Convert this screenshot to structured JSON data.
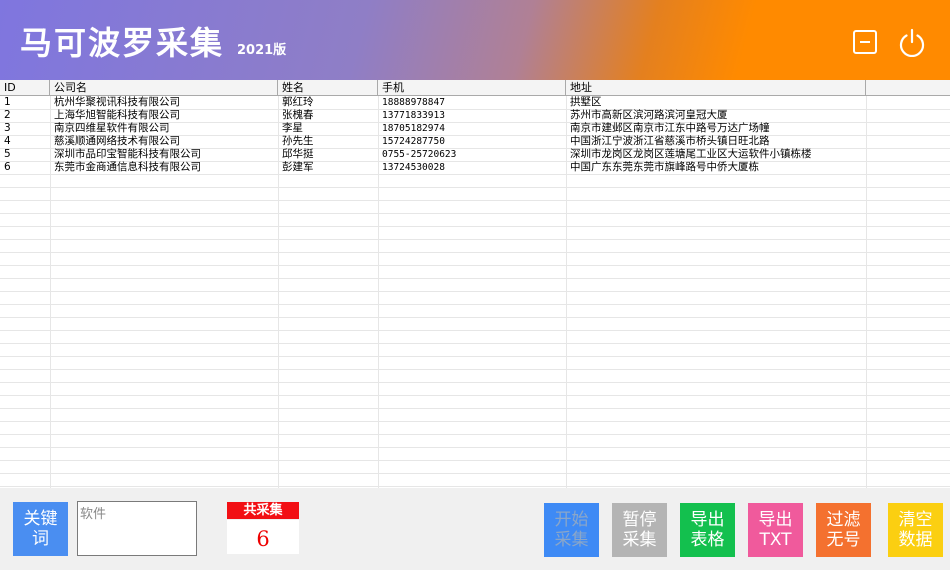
{
  "header": {
    "title": "马可波罗采集",
    "version": "2021版",
    "colors": {
      "gradient_start": "#7f76df",
      "gradient_end": "#ff8a00"
    }
  },
  "table": {
    "columns": [
      "ID",
      "公司名",
      "姓名",
      "手机",
      "地址"
    ],
    "rows": [
      [
        "1",
        "杭州华聚视讯科技有限公司",
        "郭红玲",
        "18888978847",
        "拱墅区"
      ],
      [
        "2",
        "上海华旭智能科技有限公司",
        "张槐春",
        "13771833913",
        "苏州市高新区滨河路滨河皇冠大厦"
      ],
      [
        "3",
        "南京四维星软件有限公司",
        "李星",
        "18705182974",
        "南京市建邺区南京市江东中路号万达广场幢"
      ],
      [
        "4",
        "慈溪顺通网络技术有限公司",
        "孙先生",
        "15724287750",
        "中国浙江宁波浙江省慈溪市桥头镇日旺北路"
      ],
      [
        "5",
        "深圳市品印宝智能科技有限公司",
        "邱华挺",
        "0755-25720623",
        "深圳市龙岗区龙岗区莲塘尾工业区大运软件小镇栋楼"
      ],
      [
        "6",
        "东莞市金商通信息科技有限公司",
        "彭建军",
        "13724530028",
        "中国广东东莞东莞市旗峰路号中侨大厦栋"
      ]
    ]
  },
  "footer": {
    "keyword_button": "关键\n词",
    "keyword_value": "软件",
    "count_label": "共采集",
    "count_value": "6",
    "start_button": "开始\n采集",
    "pause_button": "暂停\n采集",
    "export_xls_button": "导出\n表格",
    "export_txt_button": "导出\nTXT",
    "filter_button": "过滤\n无号",
    "clear_button": "清空\n数据"
  }
}
